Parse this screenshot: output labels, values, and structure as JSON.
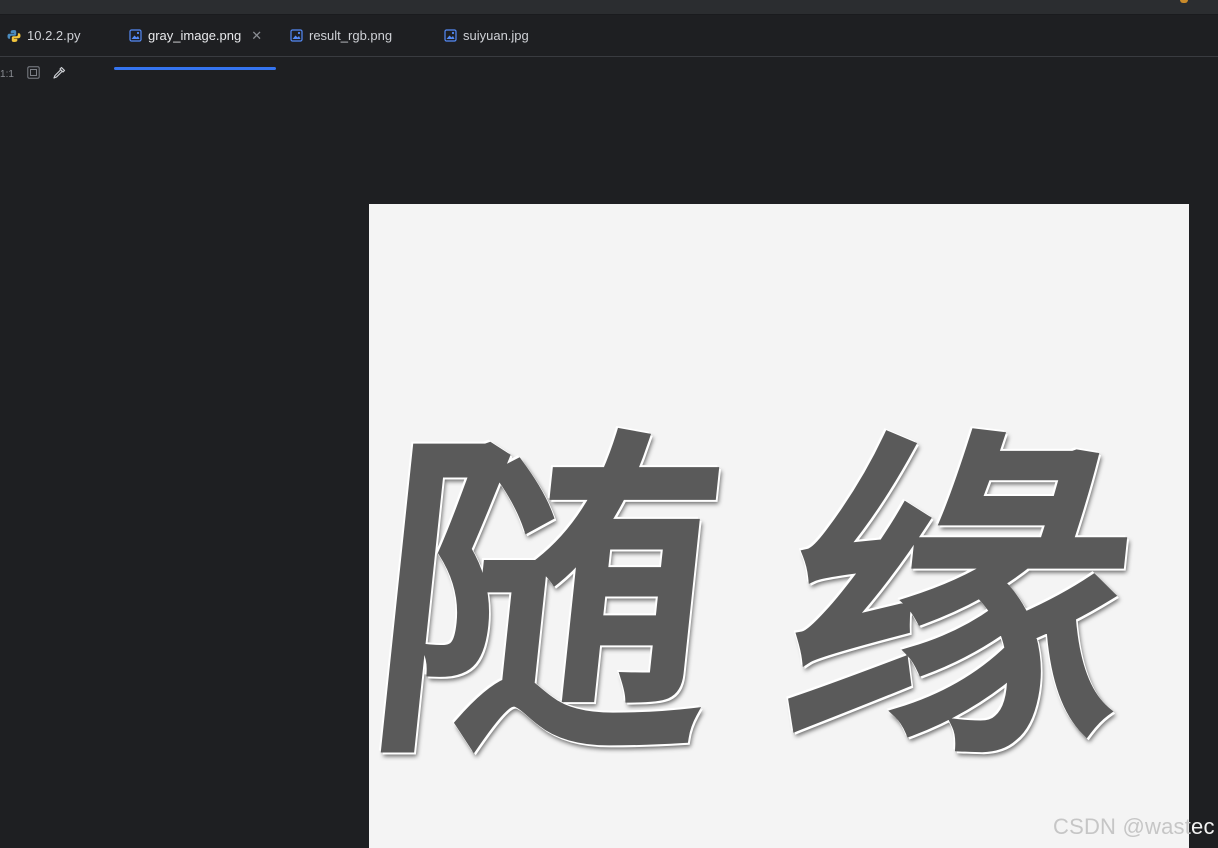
{
  "tabs": [
    {
      "label": "10.2.2.py",
      "icon": "python-file-icon",
      "active": false
    },
    {
      "label": "gray_image.png",
      "icon": "image-file-icon",
      "active": true,
      "closable": true
    },
    {
      "label": "result_rgb.png",
      "icon": "image-file-icon",
      "active": false
    },
    {
      "label": "suiyuan.jpg",
      "icon": "image-file-icon",
      "active": false
    }
  ],
  "toolbar": {
    "zoom_label": "1:1",
    "fit_icon": "fit-to-screen-icon",
    "color_picker_icon": "eyedropper-icon"
  },
  "image": {
    "characters": [
      "随",
      "缘"
    ]
  },
  "watermark": {
    "text": "CSDN @wast",
    "tail": "ec"
  },
  "colors": {
    "background": "#1e1f22",
    "tab_accent": "#3574f0",
    "image_bg": "#f4f4f4",
    "glyph": "#5a5a5a"
  }
}
